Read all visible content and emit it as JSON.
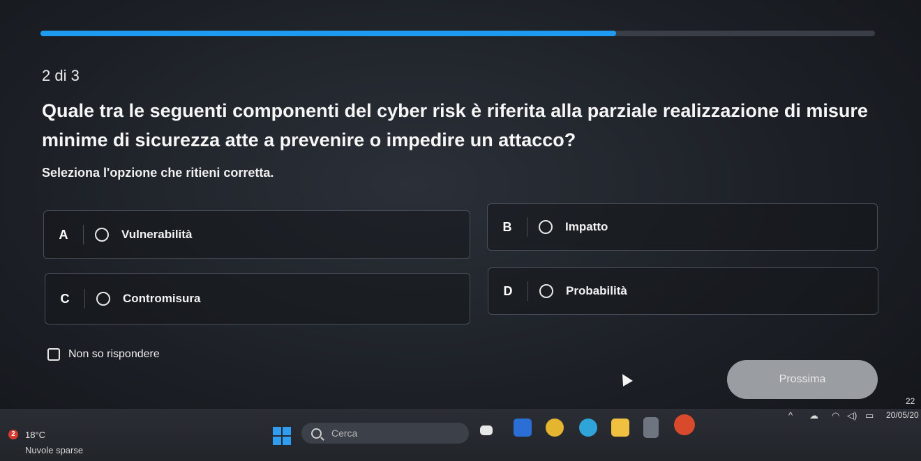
{
  "quiz": {
    "progress_percent": 69,
    "counter": "2 di 3",
    "question": "Quale tra le seguenti componenti del cyber risk è riferita alla parziale realizzazione di misure minime di sicurezza atte a prevenire o impedire un attacco?",
    "instruction": "Seleziona l'opzione che ritieni corretta.",
    "options": [
      {
        "letter": "A",
        "label": "Vulnerabilità"
      },
      {
        "letter": "B",
        "label": "Impatto"
      },
      {
        "letter": "C",
        "label": "Contromisura"
      },
      {
        "letter": "D",
        "label": "Probabilità"
      }
    ],
    "dont_know": "Non so rispondere",
    "next_label": "Prossima"
  },
  "taskbar": {
    "weather_badge": "2",
    "temperature": "18°C",
    "weather_desc": "Nuvole sparse",
    "search_placeholder": "Cerca",
    "clock_time": "22",
    "clock_date": "20/05/20"
  },
  "colors": {
    "accent": "#1e9bf0",
    "next_button": "#9a9da2"
  }
}
